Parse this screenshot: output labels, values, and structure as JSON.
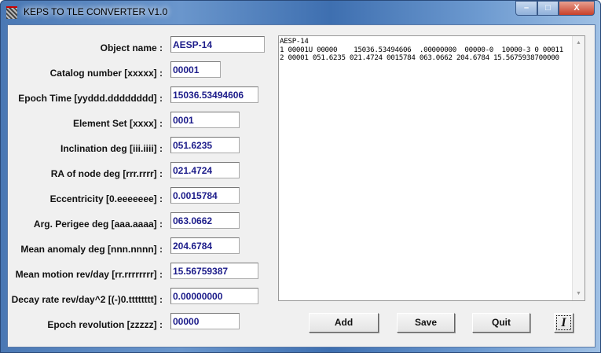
{
  "window": {
    "title": "KEPS TO TLE CONVERTER V1.0",
    "minimize": "–",
    "maximize": "□",
    "close": "X"
  },
  "fields": [
    {
      "label": "Object name :",
      "value": "AESP-14"
    },
    {
      "label": "Catalog number [xxxxx] :",
      "value": "00001"
    },
    {
      "label": "Epoch Time [yyddd.dddddddd] :",
      "value": "15036.53494606"
    },
    {
      "label": "Element Set [xxxx] :",
      "value": "0001"
    },
    {
      "label": "Inclination deg [iii.iiii] :",
      "value": "051.6235"
    },
    {
      "label": "RA of node deg [rrr.rrrr] :",
      "value": "021.4724"
    },
    {
      "label": "Eccentricity [0.eeeeeee] :",
      "value": "0.0015784"
    },
    {
      "label": "Arg. Perigee deg [aaa.aaaa] :",
      "value": "063.0662"
    },
    {
      "label": "Mean anomaly deg [nnn.nnnn] :",
      "value": "204.6784"
    },
    {
      "label": "Mean motion rev/day [rr.rrrrrrrr] :",
      "value": "15.56759387"
    },
    {
      "label": "Decay rate rev/day^2 [(-)0.tttttttt] :",
      "value": "0.00000000"
    },
    {
      "label": "Epoch revolution [zzzzz] :",
      "value": "00000"
    }
  ],
  "output": "AESP-14\n1 00001U 00000    15036.53494606  .00000000  00000-0  10000-3 0 00011\n2 00001 051.6235 021.4724 0015784 063.0662 204.6784 15.5675938700000",
  "buttons": {
    "add": "Add",
    "save": "Save",
    "quit": "Quit",
    "info": "I"
  }
}
